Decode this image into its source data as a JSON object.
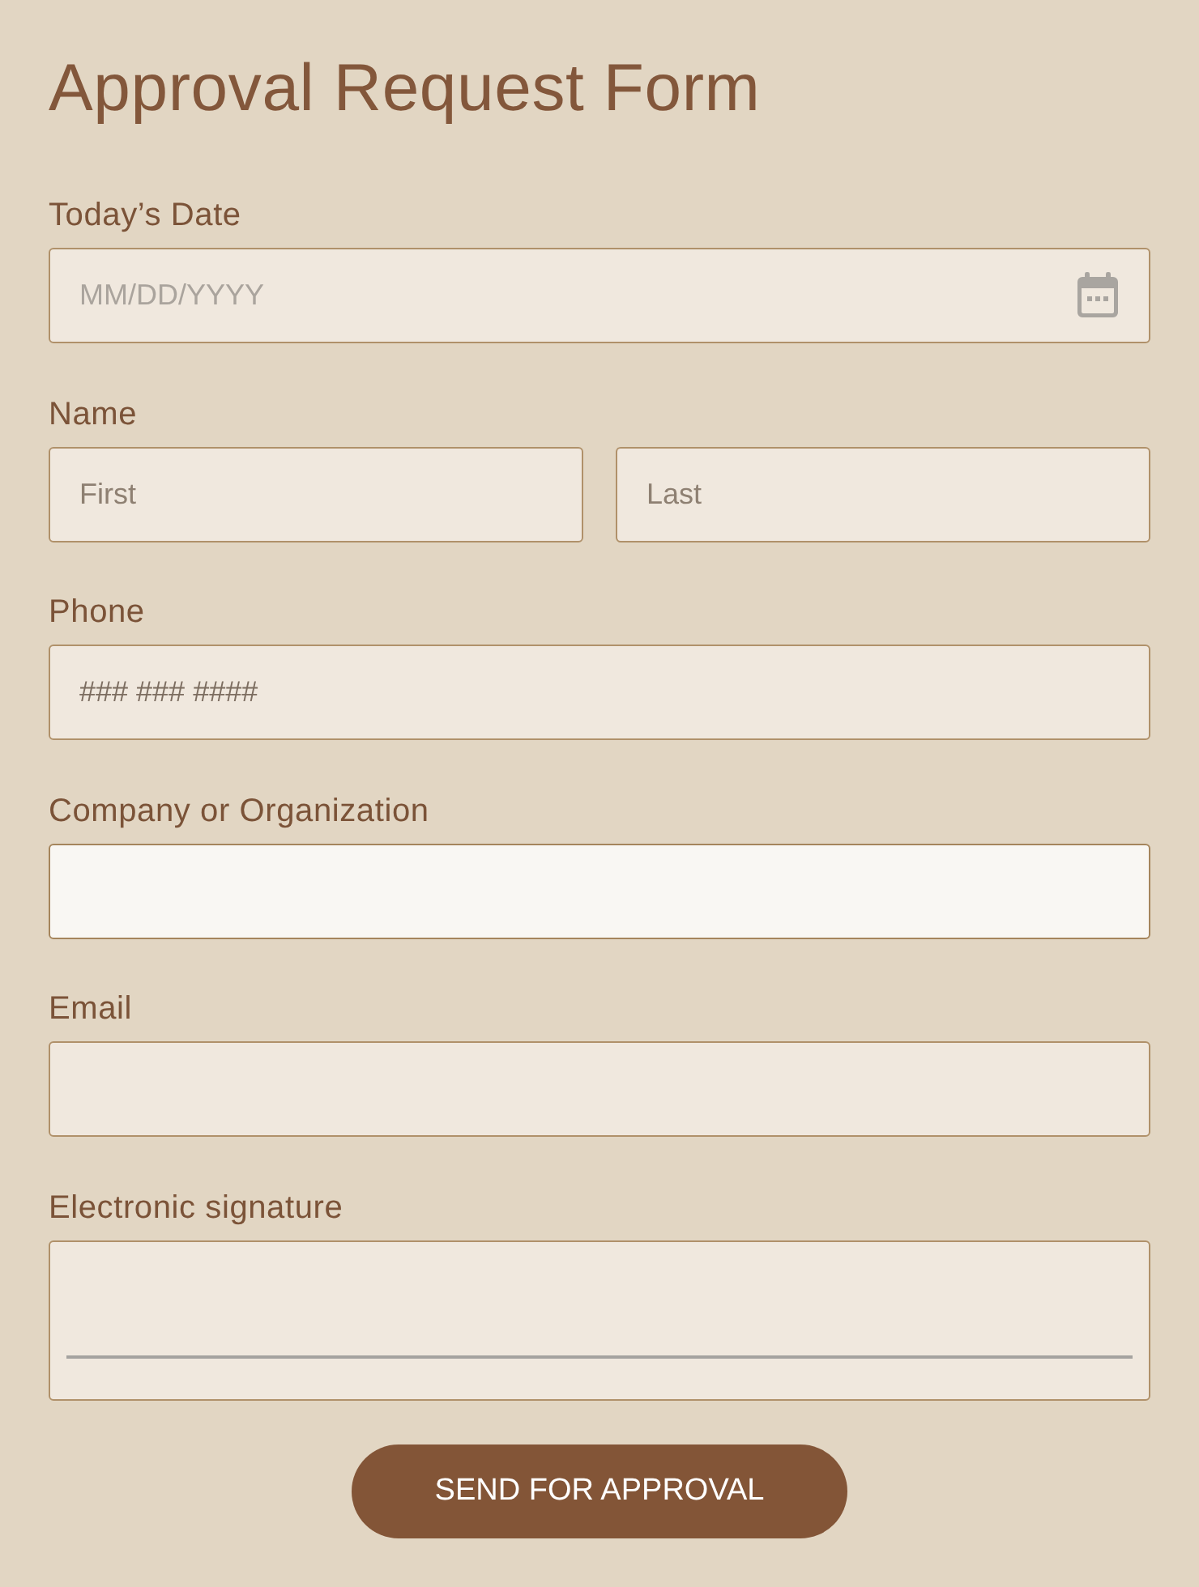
{
  "title": "Approval Request Form",
  "fields": [
    {
      "kind": "date",
      "label": "Today’s Date",
      "placeholder": "MM/DD/YYYY",
      "focused": false
    },
    {
      "kind": "name",
      "label": "Name",
      "parts": [
        {
          "placeholder": "First"
        },
        {
          "placeholder": "Last"
        }
      ],
      "focused": false
    },
    {
      "kind": "phone",
      "label": "Phone",
      "placeholder": "### ### ####",
      "focused": false
    },
    {
      "kind": "company",
      "label": "Company or Organization",
      "focused": true
    },
    {
      "kind": "email",
      "label": "Email",
      "focused": false
    },
    {
      "kind": "signature",
      "label": "Electronic signature",
      "focused": false
    }
  ],
  "submit_button": {
    "label": "SEND FOR APPROVAL"
  }
}
